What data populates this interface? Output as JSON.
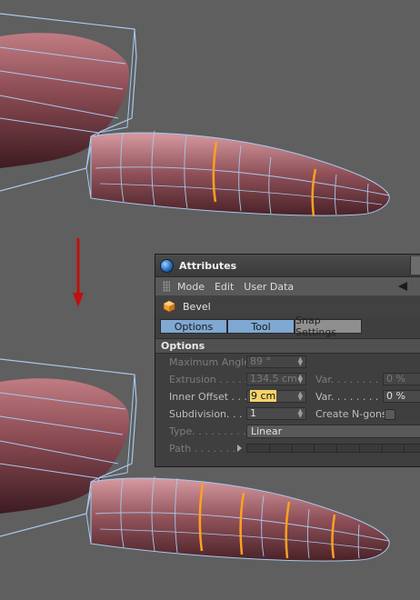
{
  "panel": {
    "title": "Attributes",
    "menu": [
      "Mode",
      "Edit",
      "User Data"
    ],
    "object_name": "Bevel",
    "tabs": [
      "Options",
      "Tool",
      "Snap Settings"
    ],
    "section": "Options",
    "fields": {
      "max_angle_label": "Maximum Angle",
      "max_angle_value": "89 °",
      "extrusion_label": "Extrusion . . . . .",
      "extrusion_value": "134.5 cm",
      "inner_offset_label": "Inner Offset . . .",
      "inner_offset_value": "9 cm",
      "subdivision_label": "Subdivision. . . .",
      "subdivision_value": "1",
      "type_label": "Type. . . . . . . . .",
      "type_value": "Linear",
      "path_label": "Path . . . . . . .",
      "var_label_1": "Var. . . . . . . . .",
      "var_value_1": "0 %",
      "var_label_2": "Var. . . . . . . . .",
      "var_value_2": "0 %",
      "create_ngons_label": "Create N-gons"
    }
  },
  "colors": {
    "viewport_bg": "#5f5f5f",
    "mesh": "#8a4a52",
    "wire": "#a8c8ee",
    "edge_loop": "#ffa020",
    "arrow": "#c01010",
    "tab_active": "#7fa8d2"
  }
}
